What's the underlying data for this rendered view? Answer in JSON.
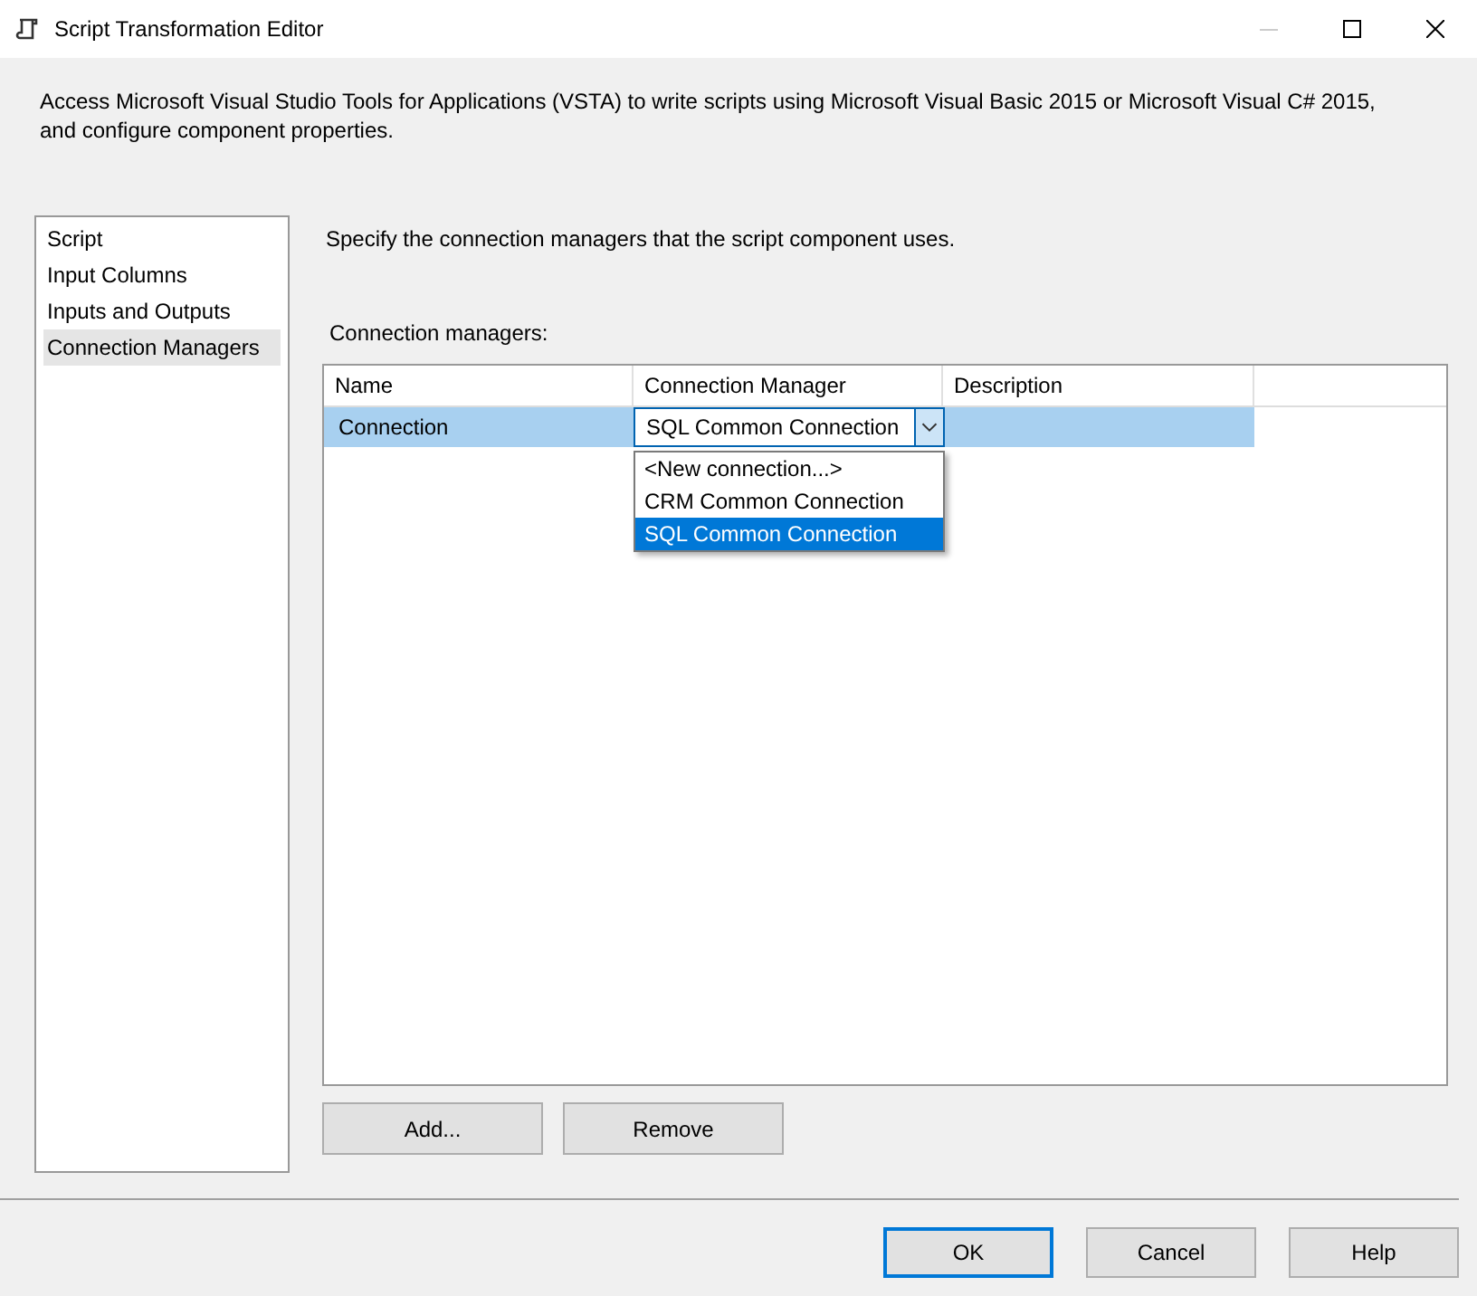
{
  "window": {
    "title": "Script Transformation Editor"
  },
  "description": "Access Microsoft Visual Studio Tools for Applications (VSTA) to write scripts using Microsoft Visual Basic 2015 or Microsoft Visual C# 2015, and configure component properties.",
  "sidebar": {
    "items": [
      {
        "label": "Script",
        "selected": false
      },
      {
        "label": "Input Columns",
        "selected": false
      },
      {
        "label": "Inputs and Outputs",
        "selected": false
      },
      {
        "label": "Connection Managers",
        "selected": true
      }
    ]
  },
  "instruction": "Specify the connection managers that the script component uses.",
  "section_label": "Connection managers:",
  "table": {
    "columns": [
      "Name",
      "Connection Manager",
      "Description"
    ],
    "rows": [
      {
        "name": "Connection",
        "connection_manager": "SQL Common Connection",
        "selected": true
      }
    ]
  },
  "dropdown": {
    "options": [
      {
        "label": "<New connection...>",
        "selected": false
      },
      {
        "label": "CRM Common Connection",
        "selected": false
      },
      {
        "label": "SQL Common Connection",
        "selected": true
      }
    ]
  },
  "table_buttons": [
    "Add...",
    "Remove"
  ],
  "dialog_buttons": [
    {
      "label": "OK",
      "default": true
    },
    {
      "label": "Cancel",
      "default": false
    },
    {
      "label": "Help",
      "default": false
    }
  ]
}
